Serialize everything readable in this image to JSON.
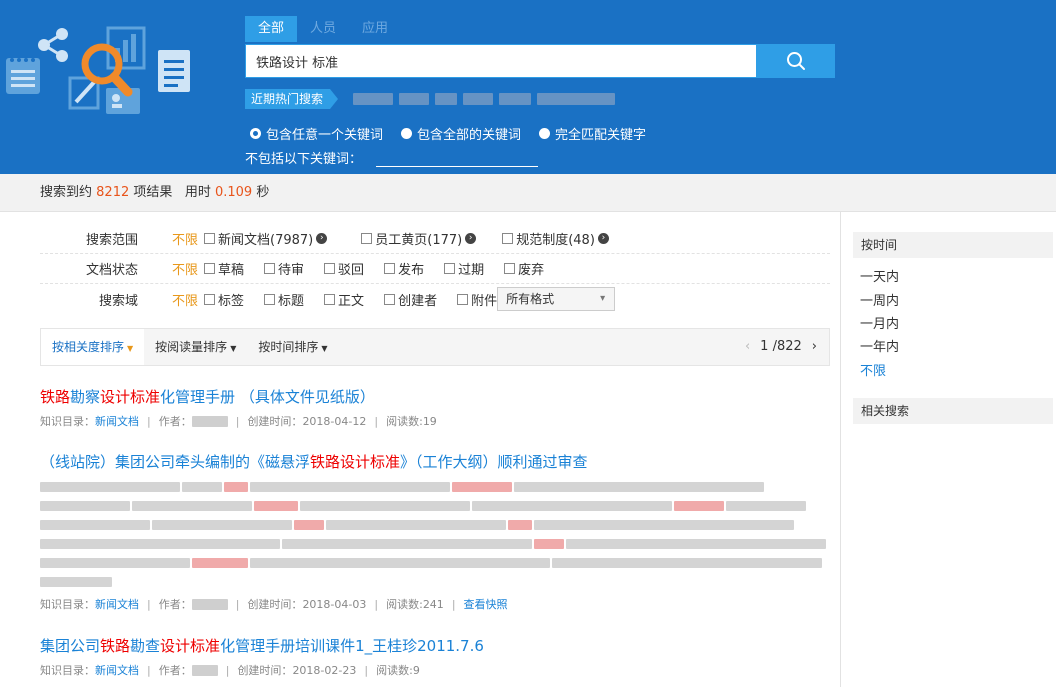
{
  "search": {
    "tabs": [
      {
        "label": "全部",
        "active": true
      },
      {
        "label": "人员",
        "active": false
      },
      {
        "label": "应用",
        "active": false
      }
    ],
    "query": "铁路设计 标准",
    "hot_label": "近期热门搜索",
    "match_options": [
      {
        "label": "包含任意一个关键词",
        "checked": true
      },
      {
        "label": "包含全部的关键词",
        "checked": false
      },
      {
        "label": "完全匹配关键字",
        "checked": false
      }
    ],
    "exclude_label": "不包括以下关键词："
  },
  "summary": {
    "prefix": "搜索到约",
    "count": "8212",
    "middle": "项结果",
    "time_label": "用时",
    "time": "0.109",
    "unit": "秒"
  },
  "filters": {
    "scope": {
      "label": "搜索范围",
      "unlimited": "不限",
      "options": [
        "新闻文档(7987)",
        "员工黄页(177)",
        "规范制度(48)"
      ]
    },
    "status": {
      "label": "文档状态",
      "unlimited": "不限",
      "options": [
        "草稿",
        "待审",
        "驳回",
        "发布",
        "过期",
        "废弃"
      ]
    },
    "field": {
      "label": "搜索域",
      "unlimited": "不限",
      "options": [
        "标签",
        "标题",
        "正文",
        "创建者",
        "附件"
      ],
      "format_select": "所有格式"
    }
  },
  "sort": {
    "items": [
      {
        "label": "按相关度排序",
        "active": true
      },
      {
        "label": "按阅读量排序",
        "active": false
      },
      {
        "label": "按时间排序",
        "active": false
      }
    ],
    "page": "1",
    "total_pages": "/822",
    "prev": "‹",
    "next": "›"
  },
  "results": [
    {
      "title_segments": [
        {
          "text": "铁路",
          "hl": true
        },
        {
          "text": "勘察",
          "hl": false
        },
        {
          "text": "设计标准",
          "hl": true
        },
        {
          "text": "化管理手册 （具体文件见纸版）",
          "hl": false
        }
      ],
      "catalog_label": "知识目录：",
      "catalog": "新闻文档",
      "author_label": "作者：",
      "created_label": "创建时间：",
      "created": "2018-04-12",
      "reads_label": "阅读数:",
      "reads": "19"
    },
    {
      "title_segments": [
        {
          "text": "（线站院）集团公司牵头编制的《磁悬浮",
          "hl": false
        },
        {
          "text": "铁路设计标准",
          "hl": true
        },
        {
          "text": "》（工作大纲）顺利通过审查",
          "hl": false
        }
      ],
      "catalog_label": "知识目录：",
      "catalog": "新闻文档",
      "author_label": "作者：",
      "created_label": "创建时间：",
      "created": "2018-04-03",
      "reads_label": "阅读数:",
      "reads": "241",
      "snapshot": "查看快照"
    },
    {
      "title_segments": [
        {
          "text": "集团公司",
          "hl": false
        },
        {
          "text": "铁路",
          "hl": true
        },
        {
          "text": "勘查",
          "hl": false
        },
        {
          "text": "设计标准",
          "hl": true
        },
        {
          "text": "化管理手册培训课件1_王桂珍2011.7.6",
          "hl": false
        }
      ],
      "catalog_label": "知识目录：",
      "catalog": "新闻文档",
      "author_label": "作者：",
      "created_label": "创建时间：",
      "created": "2018-02-23",
      "reads_label": "阅读数:",
      "reads": "9"
    }
  ],
  "side": {
    "time_title": "按时间",
    "time_options": [
      {
        "label": "一天内",
        "active": false
      },
      {
        "label": "一周内",
        "active": false
      },
      {
        "label": "一月内",
        "active": false
      },
      {
        "label": "一年内",
        "active": false
      },
      {
        "label": "不限",
        "active": true
      }
    ],
    "related_title": "相关搜索"
  },
  "colors": {
    "header_bg": "#1a71c4",
    "accent": "#2f9ee6",
    "highlight": "#e00000",
    "orange": "#e8981b",
    "link": "#1a82d6"
  }
}
